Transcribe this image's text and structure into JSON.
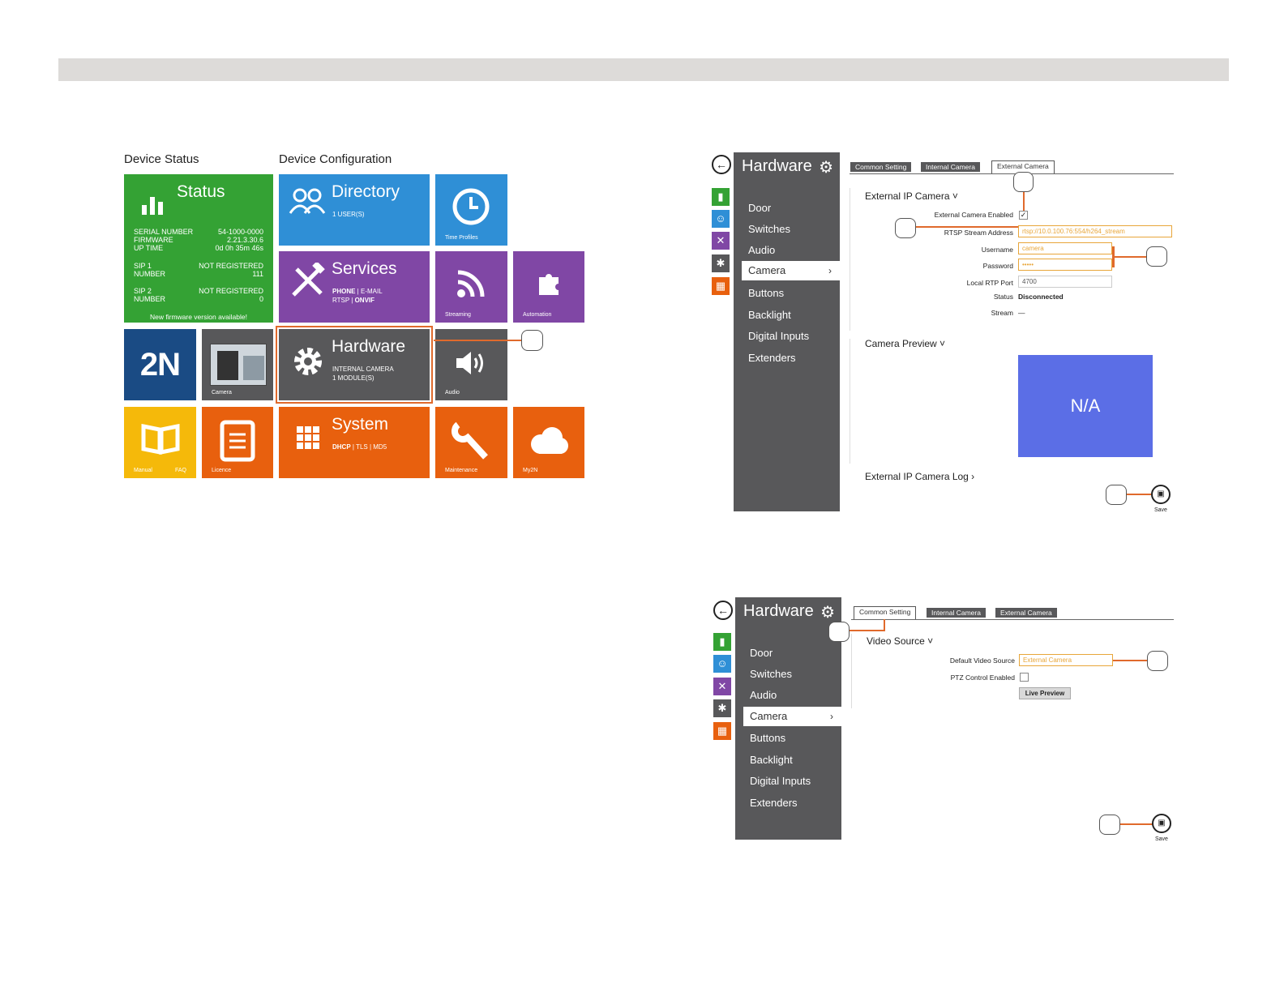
{
  "sections": {
    "status_title": "Device Status",
    "config_title": "Device Configuration"
  },
  "tiles": {
    "status": {
      "title": "Status",
      "serial_label": "SERIAL NUMBER",
      "serial_value": "54-1000-0000",
      "firmware_label": "FIRMWARE",
      "firmware_value": "2.21.3.30.6",
      "uptime_label": "UP TIME",
      "uptime_value": "0d 0h 35m 46s",
      "sip1_label_a": "SIP 1",
      "sip1_label_b": "NUMBER",
      "sip1_state": "NOT REGISTERED",
      "sip1_number": "111",
      "sip2_label_a": "SIP 2",
      "sip2_label_b": "NUMBER",
      "sip2_state": "NOT REGISTERED",
      "sip2_number": "0",
      "firmware_notice": "New firmware version available!"
    },
    "directory": {
      "title": "Directory",
      "sub": "1 USER(S)"
    },
    "time_profiles": {
      "label": "Time Profiles"
    },
    "services": {
      "title": "Services",
      "sub1_a": "PHONE",
      "sub1_b": " | E-MAIL",
      "sub2_a": "RTSP | ",
      "sub2_b": "ONVIF"
    },
    "streaming": {
      "label": "Streaming"
    },
    "automation": {
      "label": "Automation"
    },
    "logo": {
      "text": "2N"
    },
    "camera": {
      "label": "Camera"
    },
    "hardware": {
      "title": "Hardware",
      "sub1": "INTERNAL CAMERA",
      "sub2": "1 MODULE(S)"
    },
    "audio": {
      "label": "Audio"
    },
    "manual": {
      "label_a": "Manual",
      "label_b": "FAQ"
    },
    "licence": {
      "label": "Licence"
    },
    "system": {
      "title": "System",
      "sub_a": "DHCP",
      "sub_b": " | TLS | MD5"
    },
    "maintenance": {
      "label": "Maintenance"
    },
    "my2n": {
      "label": "My2N"
    }
  },
  "panel_top": {
    "title": "Hardware",
    "menu": [
      "Door",
      "Switches",
      "Audio",
      "Camera",
      "Buttons",
      "Backlight",
      "Digital Inputs",
      "Extenders"
    ],
    "tabs": [
      "Common Setting",
      "Internal Camera",
      "External Camera"
    ],
    "section1": "External IP Camera ˅",
    "enabled_label": "External Camera Enabled",
    "rtsp_label": "RTSP Stream Address",
    "rtsp_value": "rtsp://10.0.100.76:554/h264_stream",
    "username_label": "Username",
    "username_value": "camera",
    "password_label": "Password",
    "password_value": "•••••",
    "port_label": "Local RTP Port",
    "port_value": "4700",
    "status_label": "Status",
    "status_value": "Disconnected",
    "stream_label": "Stream",
    "stream_value": "—",
    "section2": "Camera Preview ˅",
    "preview_text": "N/A",
    "section3": "External IP Camera Log ›",
    "save_label": "Save"
  },
  "panel_bottom": {
    "title": "Hardware",
    "menu": [
      "Door",
      "Switches",
      "Audio",
      "Camera",
      "Buttons",
      "Backlight",
      "Digital Inputs",
      "Extenders"
    ],
    "tabs": [
      "Common Setting",
      "Internal Camera",
      "External Camera"
    ],
    "section1": "Video Source ˅",
    "default_label": "Default Video Source",
    "default_value": "External Camera",
    "ptz_label": "PTZ Control Enabled",
    "live_preview": "Live Preview",
    "save_label": "Save"
  },
  "colors": {
    "green": "#34a234",
    "blue": "#2f8fd6",
    "purple": "#8047a5",
    "dark": "#58585a",
    "navy": "#1a4b84",
    "yellow": "#f5b90a",
    "orange": "#e8600e",
    "callout": "#e06a2c",
    "preview": "#5b6ee6"
  }
}
